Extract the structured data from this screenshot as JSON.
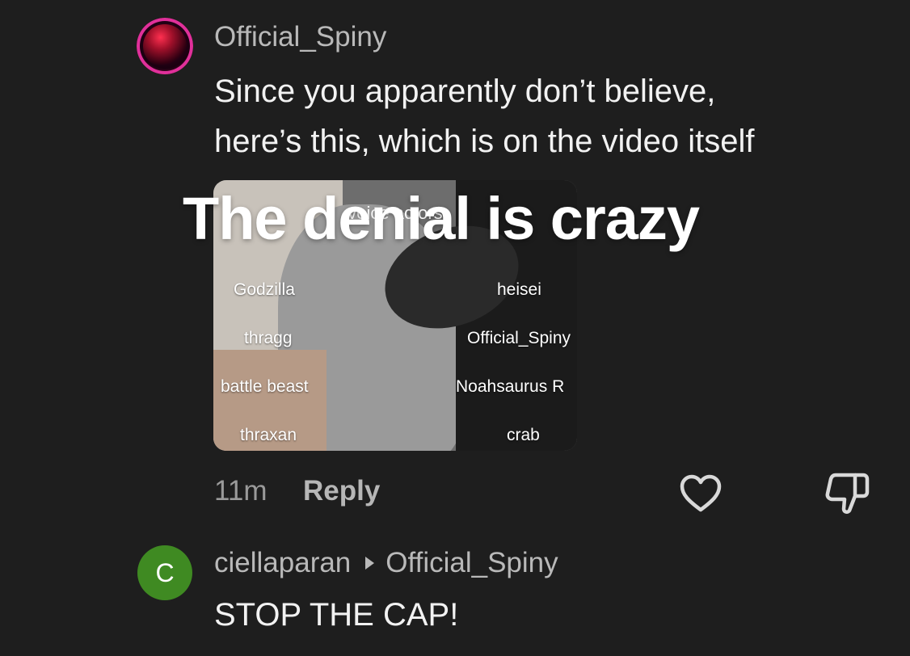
{
  "comment1": {
    "username": "Official_Spiny",
    "text_line1": "Since you apparently don’t believe,",
    "text_line2": "here’s this, which is on the video itself",
    "time": "11m",
    "reply_label": "Reply"
  },
  "attachment": {
    "title": "voice actors",
    "cast": [
      {
        "role": "Godzilla",
        "actor": "heisei"
      },
      {
        "role": "thragg",
        "actor": "Official_Spiny"
      },
      {
        "role": "battle beast",
        "actor": "Noahsaurus R"
      },
      {
        "role": "thraxan",
        "actor": "crab"
      }
    ]
  },
  "overlay_caption": "The denial is crazy",
  "comment2": {
    "avatar_letter": "C",
    "username": "ciellaparan",
    "reply_to": "Official_Spiny",
    "text": "STOP THE CAP!"
  },
  "icons": {
    "like": "heart-icon",
    "dislike": "thumbs-down-icon",
    "reply_arrow": "caret-right-icon"
  },
  "colors": {
    "background": "#1e1e1e",
    "avatar2": "#3f8a22",
    "username": "#b9b9b9"
  }
}
